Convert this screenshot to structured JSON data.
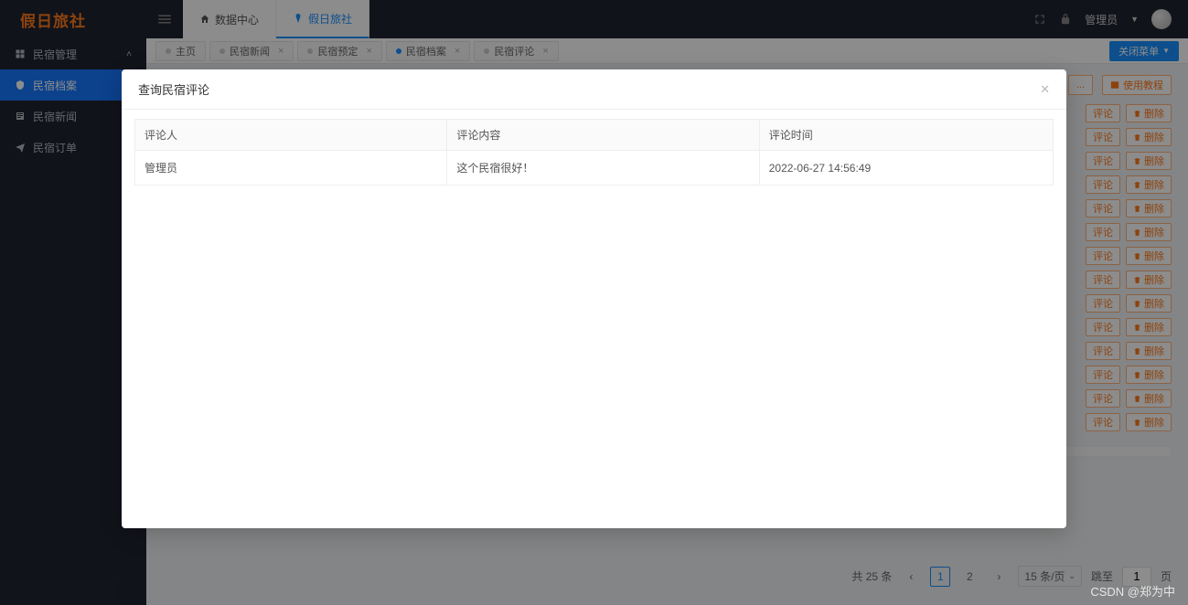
{
  "brand": "假日旅社",
  "header": {
    "nav": [
      {
        "label": "数据中心",
        "active": false
      },
      {
        "label": "假日旅社",
        "active": true
      }
    ],
    "user": "管理员"
  },
  "sidebar": [
    {
      "label": "民宿管理",
      "expand": true
    },
    {
      "label": "民宿档案",
      "active": true
    },
    {
      "label": "民宿新闻"
    },
    {
      "label": "民宿订单",
      "expand": false
    }
  ],
  "tabs": {
    "items": [
      {
        "label": "主页"
      },
      {
        "label": "民宿新闻"
      },
      {
        "label": "民宿预定"
      },
      {
        "label": "民宿档案",
        "active": true
      },
      {
        "label": "民宿评论"
      }
    ],
    "close_menu": "关闭菜单"
  },
  "top_actions": {
    "hidden": "...",
    "tutorial": "使用教程"
  },
  "row_action_labels": {
    "comment": "评论",
    "delete": "删除"
  },
  "row_count": 14,
  "highlight_row": 3,
  "pager": {
    "total": "共 25 条",
    "pages": [
      "1",
      "2"
    ],
    "current": "1",
    "per": "15 条/页",
    "jump_label": "跳至",
    "jump_value": "1",
    "page_suffix": "页"
  },
  "modal": {
    "title": "查询民宿评论",
    "columns": [
      "评论人",
      "评论内容",
      "评论时间"
    ],
    "rows": [
      {
        "user": "管理员",
        "content": "这个民宿很好！",
        "time": "2022-06-27 14:56:49"
      }
    ]
  },
  "watermark": "CSDN @郑为中"
}
